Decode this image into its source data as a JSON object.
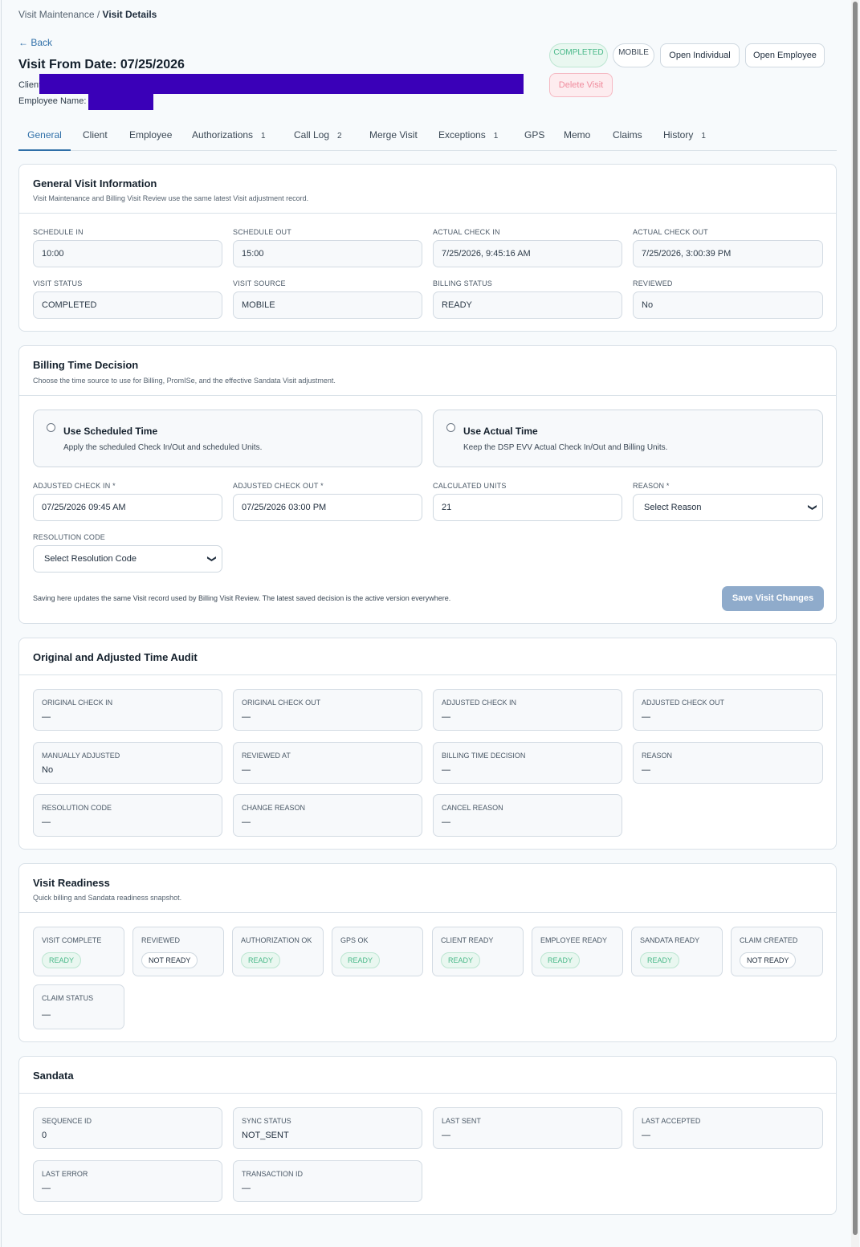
{
  "breadcrumb": {
    "parent": "Visit Maintenance",
    "sep": "/",
    "current": "Visit Details"
  },
  "back_label": "← Back",
  "title": "Visit From Date: 07/25/2026",
  "client_label": "Client",
  "employee_label": "Employee Name:",
  "header_pills": {
    "status": "COMPLETED",
    "source": "MOBILE"
  },
  "header_buttons": {
    "open_individual": "Open Individual",
    "open_employee": "Open Employee",
    "delete": "Delete Visit"
  },
  "tabs": [
    {
      "label": "General",
      "count": ""
    },
    {
      "label": "Client",
      "count": ""
    },
    {
      "label": "Employee",
      "count": ""
    },
    {
      "label": "Authorizations",
      "count": "1"
    },
    {
      "label": "Call Log",
      "count": "2"
    },
    {
      "label": "Merge Visit",
      "count": ""
    },
    {
      "label": "Exceptions",
      "count": "1"
    },
    {
      "label": "GPS",
      "count": ""
    },
    {
      "label": "Memo",
      "count": ""
    },
    {
      "label": "Claims",
      "count": ""
    },
    {
      "label": "History",
      "count": "1"
    }
  ],
  "general": {
    "title": "General Visit Information",
    "subtitle": "Visit Maintenance and Billing Visit Review use the same latest Visit adjustment record.",
    "fields": [
      {
        "label": "SCHEDULE IN",
        "value": "10:00"
      },
      {
        "label": "SCHEDULE OUT",
        "value": "15:00"
      },
      {
        "label": "ACTUAL CHECK IN",
        "value": "7/25/2026, 9:45:16 AM"
      },
      {
        "label": "ACTUAL CHECK OUT",
        "value": "7/25/2026, 3:00:39 PM"
      },
      {
        "label": "VISIT STATUS",
        "value": "COMPLETED"
      },
      {
        "label": "VISIT SOURCE",
        "value": "MOBILE"
      },
      {
        "label": "BILLING STATUS",
        "value": "READY"
      },
      {
        "label": "REVIEWED",
        "value": "No"
      }
    ]
  },
  "billing": {
    "title": "Billing Time Decision",
    "subtitle": "Choose the time source to use for Billing, PromISe, and the effective Sandata Visit adjustment.",
    "options": [
      {
        "title": "Use Scheduled Time",
        "desc": "Apply the scheduled Check In/Out and scheduled Units."
      },
      {
        "title": "Use Actual Time",
        "desc": "Keep the DSP EVV Actual Check In/Out and Billing Units."
      }
    ],
    "adjusted_in_label": "ADJUSTED CHECK IN *",
    "adjusted_in_value": "07/25/2026 09:45 AM",
    "adjusted_out_label": "ADJUSTED CHECK OUT *",
    "adjusted_out_value": "07/25/2026 03:00 PM",
    "units_label": "CALCULATED UNITS",
    "units_value": "21",
    "reason_label": "REASON *",
    "reason_value": "Select Reason",
    "resolution_label": "RESOLUTION CODE",
    "resolution_value": "Select Resolution Code",
    "note": "Saving here updates the same Visit record used by Billing Visit Review. The latest saved decision is the active version everywhere.",
    "save_label": "Save Visit Changes"
  },
  "audit": {
    "title": "Original and Adjusted Time Audit",
    "items": [
      {
        "label": "ORIGINAL CHECK IN",
        "value": "—"
      },
      {
        "label": "ORIGINAL CHECK OUT",
        "value": "—"
      },
      {
        "label": "ADJUSTED CHECK IN",
        "value": "—"
      },
      {
        "label": "ADJUSTED CHECK OUT",
        "value": "—"
      },
      {
        "label": "MANUALLY ADJUSTED",
        "value": "No"
      },
      {
        "label": "REVIEWED AT",
        "value": "—"
      },
      {
        "label": "BILLING TIME DECISION",
        "value": "—"
      },
      {
        "label": "REASON",
        "value": "—"
      },
      {
        "label": "RESOLUTION CODE",
        "value": "—"
      },
      {
        "label": "CHANGE REASON",
        "value": "—"
      },
      {
        "label": "CANCEL REASON",
        "value": "—"
      }
    ]
  },
  "readiness": {
    "title": "Visit Readiness",
    "subtitle": "Quick billing and Sandata readiness snapshot.",
    "items": [
      {
        "label": "VISIT COMPLETE",
        "value": "READY",
        "ok": true
      },
      {
        "label": "REVIEWED",
        "value": "NOT READY",
        "ok": false
      },
      {
        "label": "AUTHORIZATION OK",
        "value": "READY",
        "ok": true
      },
      {
        "label": "GPS OK",
        "value": "READY",
        "ok": true
      },
      {
        "label": "CLIENT READY",
        "value": "READY",
        "ok": true
      },
      {
        "label": "EMPLOYEE READY",
        "value": "READY",
        "ok": true
      },
      {
        "label": "SANDATA READY",
        "value": "READY",
        "ok": true
      },
      {
        "label": "CLAIM CREATED",
        "value": "NOT READY",
        "ok": false
      }
    ],
    "claim_status_label": "CLAIM STATUS",
    "claim_status_value": "—"
  },
  "sandata": {
    "title": "Sandata",
    "items": [
      {
        "label": "SEQUENCE ID",
        "value": "0"
      },
      {
        "label": "SYNC STATUS",
        "value": "NOT_SENT"
      },
      {
        "label": "LAST SENT",
        "value": "—"
      },
      {
        "label": "LAST ACCEPTED",
        "value": "—"
      },
      {
        "label": "LAST ERROR",
        "value": "—"
      },
      {
        "label": "TRANSACTION ID",
        "value": "—"
      }
    ]
  },
  "colors": {
    "accent": "#2f6fa8",
    "ready": "#49b889",
    "danger": "#f08c9d",
    "redaction": "#3a00b8"
  }
}
